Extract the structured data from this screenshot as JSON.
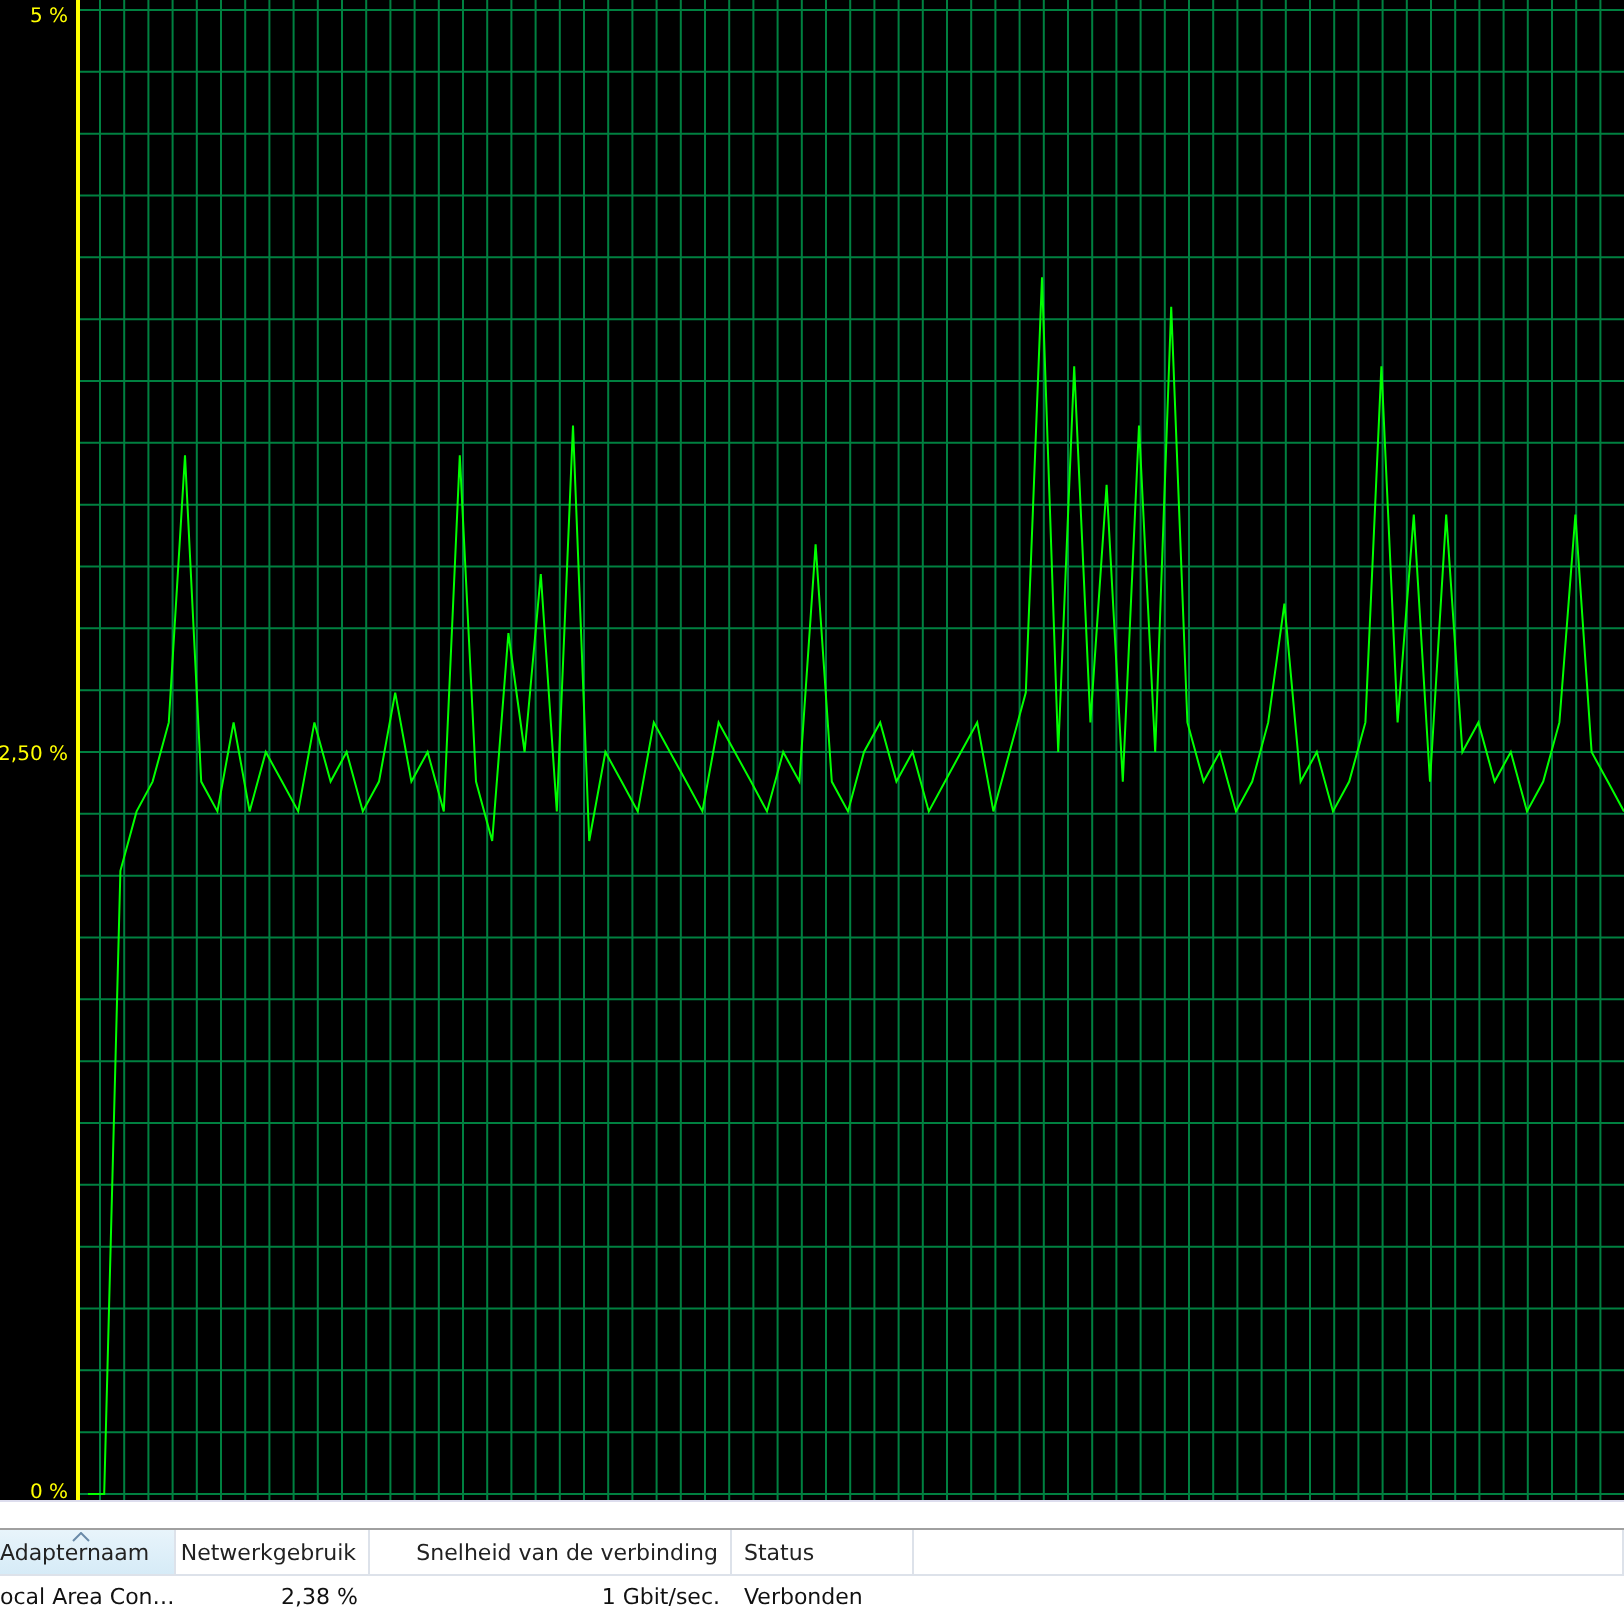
{
  "chart": {
    "chart_data": {
      "type": "line",
      "ylim": [
        0,
        5
      ],
      "yticks": [
        {
          "value": 0,
          "label": "0 %"
        },
        {
          "value": 2.5,
          "label": "2,50 %"
        },
        {
          "value": 5,
          "label": "5 %"
        }
      ],
      "grid": true,
      "series": [
        {
          "color": "#00ff00",
          "values": [
            0,
            0,
            2.1,
            2.3,
            2.4,
            2.6,
            3.5,
            2.4,
            2.3,
            2.6,
            2.3,
            2.5,
            2.4,
            2.3,
            2.6,
            2.4,
            2.5,
            2.3,
            2.4,
            2.7,
            2.4,
            2.5,
            2.3,
            3.5,
            2.4,
            2.2,
            2.9,
            2.5,
            3.1,
            2.3,
            3.6,
            2.2,
            2.5,
            2.4,
            2.3,
            2.6,
            2.5,
            2.4,
            2.3,
            2.6,
            2.5,
            2.4,
            2.3,
            2.5,
            2.4,
            3.2,
            2.4,
            2.3,
            2.5,
            2.6,
            2.4,
            2.5,
            2.3,
            2.4,
            2.5,
            2.6,
            2.3,
            2.5,
            2.7,
            4.1,
            2.5,
            3.8,
            2.6,
            3.4,
            2.4,
            3.6,
            2.5,
            4.0,
            2.6,
            2.4,
            2.5,
            2.3,
            2.4,
            2.6,
            3.0,
            2.4,
            2.5,
            2.3,
            2.4,
            2.6,
            3.8,
            2.6,
            3.3,
            2.4,
            3.3,
            2.5,
            2.6,
            2.4,
            2.5,
            2.3,
            2.4,
            2.6,
            3.3,
            2.5,
            2.4,
            2.3
          ]
        }
      ]
    }
  },
  "table": {
    "columns": [
      {
        "label": "Adapternaam",
        "sorted": true
      },
      {
        "label": "Netwerkgebruik",
        "sorted": false
      },
      {
        "label": "Snelheid van de verbinding",
        "sorted": false
      },
      {
        "label": "Status",
        "sorted": false
      }
    ],
    "rows": [
      {
        "cells": [
          "ocal Area Con…",
          "2,38 %",
          "1 Gbit/sec.",
          "Verbonden"
        ]
      }
    ]
  }
}
